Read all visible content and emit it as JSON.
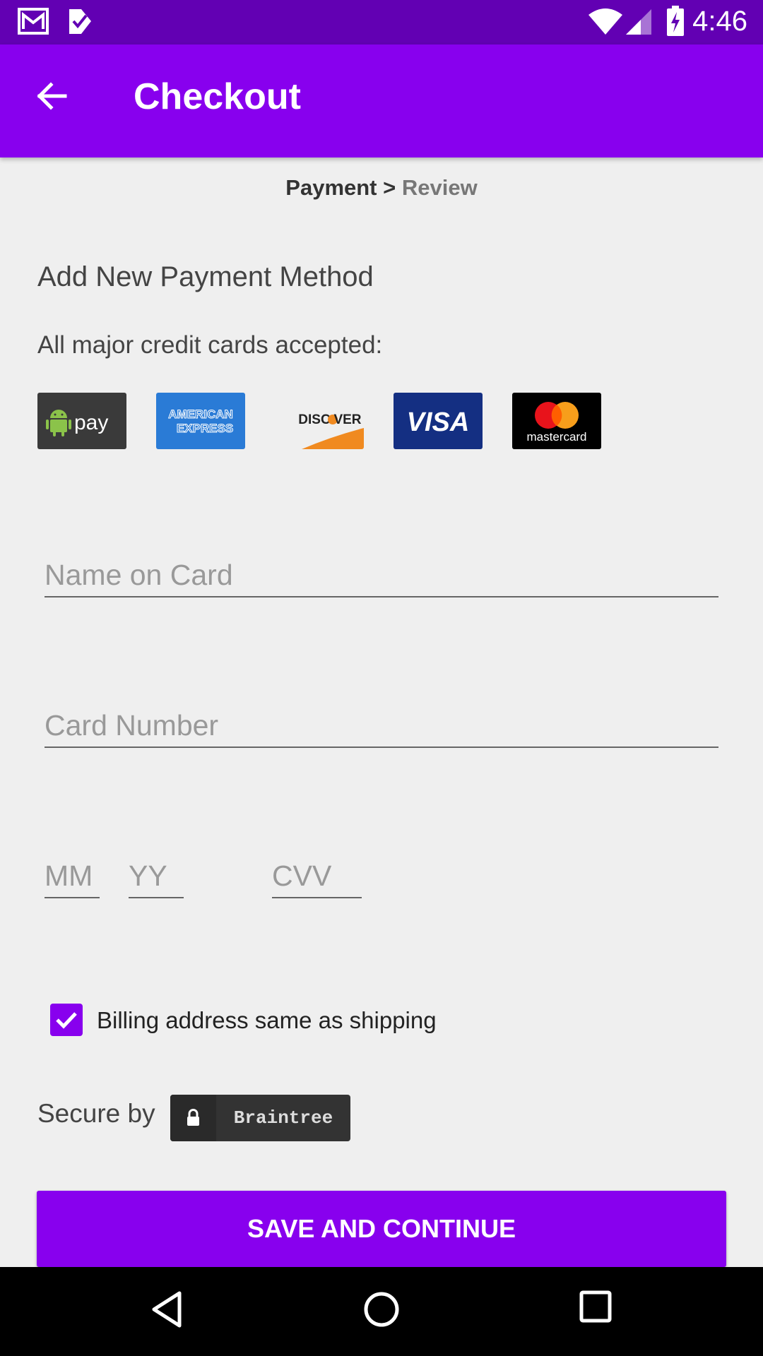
{
  "status_bar": {
    "time": "4:46",
    "icons": [
      "gmail-icon",
      "check-app-icon",
      "wifi-icon",
      "signal-icon",
      "battery-icon"
    ]
  },
  "app_bar": {
    "title": "Checkout",
    "back_icon": "arrow-back-icon"
  },
  "breadcrumb": {
    "current": "Payment",
    "separator": ">",
    "next": "Review"
  },
  "form": {
    "section_title": "Add New Payment Method",
    "accepted_text": "All major credit cards accepted:",
    "cards": [
      "android-pay",
      "american-express",
      "discover",
      "visa",
      "mastercard"
    ],
    "name_placeholder": "Name on Card",
    "number_placeholder": "Card Number",
    "month_placeholder": "MM",
    "year_placeholder": "YY",
    "cvv_placeholder": "CVV",
    "billing_checkbox_label": "Billing address same as shipping",
    "billing_checked": true,
    "secure_label": "Secure by",
    "secure_provider": "Braintree",
    "save_button": "SAVE AND CONTINUE"
  },
  "colors": {
    "status_bar": "#6200b3",
    "primary": "#8800ee",
    "background": "#efefef"
  }
}
